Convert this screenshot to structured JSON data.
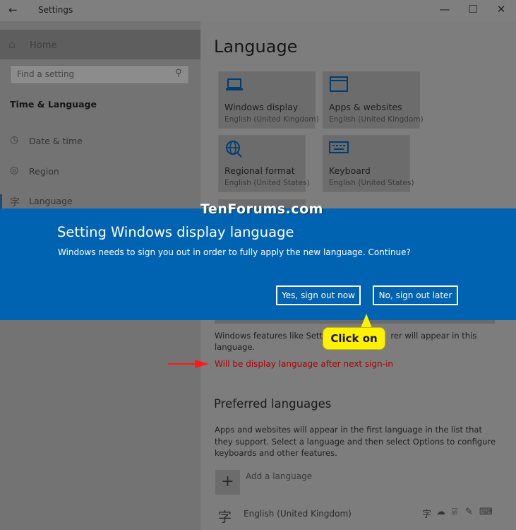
{
  "window": {
    "title": "Settings",
    "controls": {
      "minimize": "—",
      "maximize": "☐",
      "close": "✕"
    }
  },
  "sidebar": {
    "home_label": "Home",
    "search_placeholder": "Find a setting",
    "section_title": "Time & Language",
    "items": [
      {
        "label": "Date & time",
        "icon": "clock-calendar-icon"
      },
      {
        "label": "Region",
        "icon": "globe-icon"
      },
      {
        "label": "Language",
        "icon": "language-icon"
      }
    ]
  },
  "main": {
    "title": "Language",
    "tiles": [
      {
        "label": "Windows display",
        "sub": "English (United Kingdom)",
        "icon": "laptop-icon"
      },
      {
        "label": "Apps & websites",
        "sub": "English (United Kingdom)",
        "icon": "window-icon"
      },
      {
        "label": "Regional format",
        "sub": "English (United States)",
        "icon": "regional-format-icon"
      },
      {
        "label": "Keyboard",
        "sub": "English (United States)",
        "icon": "keyboard-icon"
      }
    ],
    "features_text": "Windows features like Settin",
    "features_text_end": "rer will appear in this language.",
    "status_text": "Will be display language after next sign-in",
    "preferred_heading": "Preferred languages",
    "preferred_desc": "Apps and websites will appear in the first language in the list that they support. Select a language and then select Options to configure keyboards and other features.",
    "add_language_label": "Add a language",
    "language_item": "English (United Kingdom)"
  },
  "dialog": {
    "title": "Setting Windows display language",
    "message": "Windows needs to sign you out in order to fully apply the new language. Continue?",
    "yes_button": "Yes, sign out now",
    "no_button": "No, sign out later"
  },
  "annotation": {
    "watermark": "TenForums.com",
    "callout": "Click on"
  },
  "colors": {
    "dialog_bg": "#0063b1",
    "accent_icon": "#003d71",
    "callout_bg": "#fff200",
    "status_red": "#b00000",
    "arrow_red": "#ff1a1a"
  }
}
